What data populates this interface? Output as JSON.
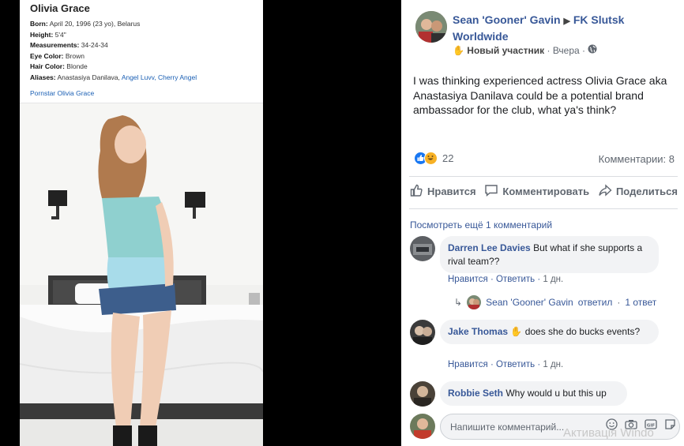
{
  "profile": {
    "name": "Olivia Grace",
    "born_label": "Born:",
    "born_value": "April 20, 1996 (23 yo), Belarus",
    "height_label": "Height:",
    "height_value": "5'4\"",
    "measurements_label": "Measurements:",
    "measurements_value": "34-24-34",
    "eye_label": "Eye Color:",
    "eye_value": "Brown",
    "hair_label": "Hair Color:",
    "hair_value": "Blonde",
    "aliases_label": "Aliases:",
    "alias_1": "Anastasiya Danilava,",
    "alias_2": "Angel Luvv,",
    "alias_3": "Cherry Angel",
    "footer_link": "Pornstar Olivia Grace"
  },
  "post": {
    "author": "Sean 'Gooner' Gavin",
    "arrow": "▶",
    "group": "FK Slutsk Worldwide",
    "badge": "Новый участник",
    "separator": "·",
    "time": "Вчера",
    "text": "I was thinking experienced actress Olivia Grace aka Anastasiya Danilava could be a potential brand ambassador for the club, what ya's think?",
    "reaction_count": "22",
    "comments_label": "Комментарии: 8"
  },
  "actions": {
    "like": "Нравится",
    "comment": "Комментировать",
    "share": "Поделиться"
  },
  "comments": {
    "view_more": "Посмотреть ещё 1 комментарий",
    "items": [
      {
        "name": "Darren Lee Davies",
        "text": "But what if she supports a rival team??",
        "like": "Нравится",
        "reply": "Ответить",
        "time": "1 дн."
      },
      {
        "name": "Jake Thomas",
        "text": "does she do bucks events?",
        "like": "Нравится",
        "reply": "Ответить",
        "time": "1 дн."
      },
      {
        "name": "Robbie Seth",
        "text": "Why would u but this up"
      }
    ],
    "reply_summary": {
      "name": "Sean 'Gooner' Gavin",
      "verb": "ответил",
      "separator": "·",
      "count": "1 ответ"
    }
  },
  "composer": {
    "placeholder": "Напишите комментарий..."
  },
  "watermark": "Активація Windo",
  "colors": {
    "link": "#385898",
    "muted": "#606770",
    "bubble": "#f2f3f5",
    "like_blue": "#1877f2",
    "haha_yellow": "#f7b125"
  }
}
